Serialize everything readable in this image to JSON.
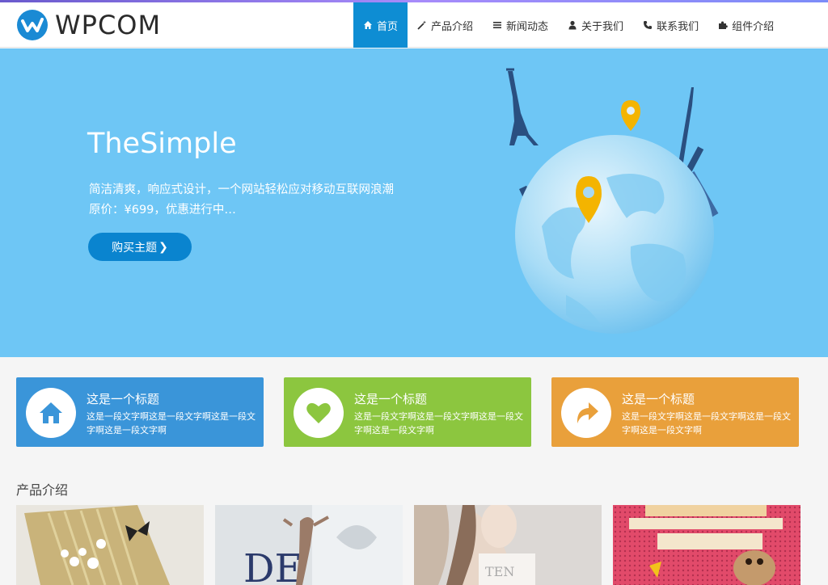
{
  "brand": {
    "name": "WPCOM",
    "icon": "wpcom-logo-icon"
  },
  "nav": [
    {
      "label": "首页",
      "icon": "home-icon",
      "active": true
    },
    {
      "label": "产品介绍",
      "icon": "wand-icon",
      "active": false
    },
    {
      "label": "新闻动态",
      "icon": "list-icon",
      "active": false
    },
    {
      "label": "关于我们",
      "icon": "user-icon",
      "active": false
    },
    {
      "label": "联系我们",
      "icon": "phone-icon",
      "active": false
    },
    {
      "label": "组件介绍",
      "icon": "puzzle-icon",
      "active": false
    }
  ],
  "banner": {
    "title": "TheSimple",
    "desc_line1": "简洁清爽，响应式设计，一个网站轻松应对移动互联网浪潮",
    "desc_line2": "原价：¥699，优惠进行中…",
    "button": "购买主题",
    "button_icon": "chevron-right-icon",
    "art": "globe-landmarks-illustration"
  },
  "features": [
    {
      "title": "这是一个标题",
      "text": "这是一段文字啊这是一段文字啊这是一段文字啊这是一段文字啊",
      "icon": "home-icon",
      "color": "#3a95d9"
    },
    {
      "title": "这是一个标题",
      "text": "这是一段文字啊这是一段文字啊这是一段文字啊这是一段文字啊",
      "icon": "heart-icon",
      "color": "#8cc63f"
    },
    {
      "title": "这是一个标题",
      "text": "这是一段文字啊这是一段文字啊这是一段文字啊这是一段文字啊",
      "icon": "share-arrow-icon",
      "color": "#e9a03b"
    }
  ],
  "products": {
    "title": "产品介绍",
    "items": [
      {
        "image": "product-image-card"
      },
      {
        "image": "product-image-dancer"
      },
      {
        "image": "product-image-model"
      },
      {
        "image": "product-image-poster"
      }
    ]
  },
  "colors": {
    "accent": "#0e8dd3",
    "banner": "#6ec6f5"
  }
}
